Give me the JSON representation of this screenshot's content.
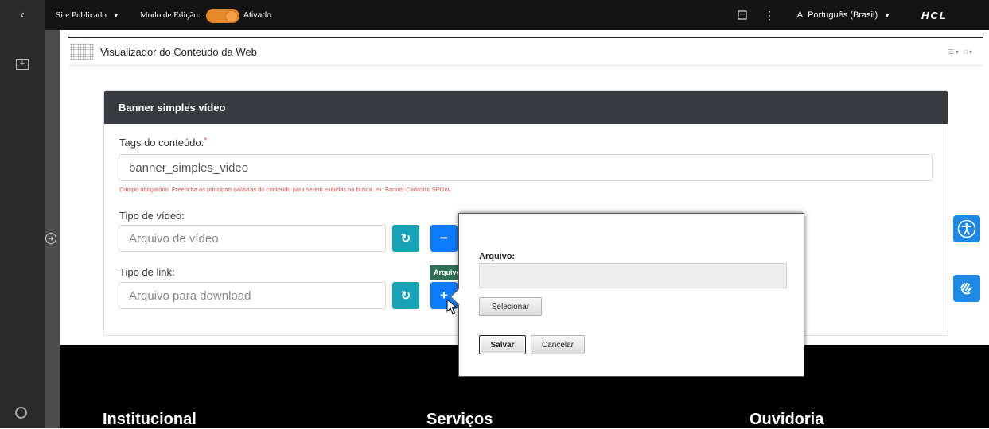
{
  "topbar": {
    "back_icon": "chevron-left-icon",
    "site_status": "Site Publicado",
    "edit_mode_label": "Modo de Edição:",
    "edit_mode_state": "Ativado",
    "edit_mode_on": true,
    "language": "Português (Brasil)",
    "brand": "HCL"
  },
  "portlet": {
    "title": "Visualizador do Conteúdo da Web"
  },
  "form": {
    "card_title": "Banner simples vídeo",
    "tags_label": "Tags do conteúdo:",
    "tags_required_mark": "*",
    "tags_value": "banner_simples_video",
    "tags_help": "Campo obrigatório. Preencha as principais palavras do conteúdo para serem exibidas na busca. ex: Banner Cadastro SPGov",
    "video_type_label": "Tipo de vídeo:",
    "video_type_placeholder": "Arquivo de vídeo",
    "link_type_label": "Tipo de link:",
    "link_type_placeholder": "Arquivo para download",
    "tooltip_text": "Arquivo"
  },
  "dialog": {
    "file_label": "Arquivo:",
    "select_label": "Selecionar",
    "save_label": "Salvar",
    "cancel_label": "Cancelar"
  },
  "footer": {
    "col1": "Institucional",
    "col2": "Serviços",
    "col3": "Ouvidoria"
  },
  "colors": {
    "toggle": "#e8892b",
    "teal_button": "#17a2b8",
    "blue_button": "#0d7bff",
    "accessibility": "#1e88e5"
  }
}
